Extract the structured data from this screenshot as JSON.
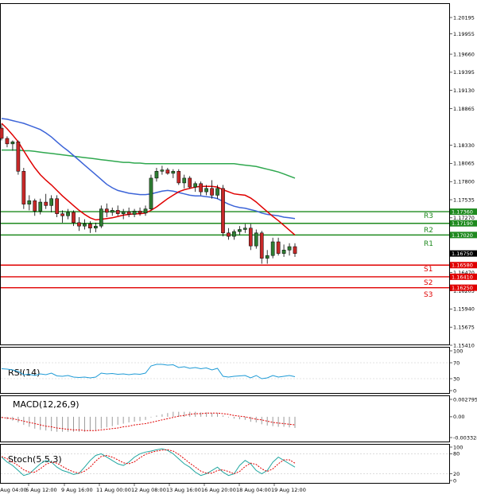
{
  "main": {
    "price_ticks": [
      "1.20195",
      "1.19955",
      "1.19660",
      "1.19395",
      "1.19130",
      "1.18865",
      "1.18330",
      "1.18065",
      "1.17800",
      "1.17535",
      "1.17270",
      "1.16470",
      "1.16205",
      "1.15940",
      "1.15675",
      "1.15410"
    ],
    "current_price": "1.16750",
    "current_color": "#000000",
    "resistance": [
      {
        "name": "R3",
        "value": "1.17360"
      },
      {
        "name": "R2",
        "value": "1.17190"
      },
      {
        "name": "R1",
        "value": "1.17020"
      }
    ],
    "support": [
      {
        "name": "S1",
        "value": "1.16580"
      },
      {
        "name": "S2",
        "value": "1.16410"
      },
      {
        "name": "S3",
        "value": "1.16250"
      }
    ],
    "resistance_color": "#1f8a1f",
    "support_color": "#e00000",
    "ma_colors": {
      "fast": "#e00000",
      "mid": "#3c64d8",
      "slow": "#2fa84f"
    }
  },
  "rsi": {
    "title": "RSI(14)",
    "ticks": [
      "100",
      "70",
      "30",
      "0"
    ],
    "color": "#1f9bd6"
  },
  "macd": {
    "title": "MACD(12,26,9)",
    "ticks": [
      "0.002795",
      "0.00",
      "-0.003328"
    ],
    "signal_color": "#e00000"
  },
  "stoch": {
    "title": "Stoch(5,5,3)",
    "ticks": [
      "100",
      "80",
      "20",
      "0"
    ],
    "main_color": "#1fa6a0",
    "signal_color": "#e00000"
  },
  "x_labels": [
    "5 Aug 04:00",
    "6 Aug 12:00",
    "9 Aug 16:00",
    "11 Aug 00:00",
    "12 Aug 08:00",
    "13 Aug 16:00",
    "16 Aug 20:00",
    "18 Aug 04:00",
    "19 Aug 12:00"
  ],
  "chart_data": {
    "type": "candlestick",
    "candles": [
      {
        "o": 1.1858,
        "h": 1.1864,
        "l": 1.184,
        "c": 1.1843
      },
      {
        "o": 1.1843,
        "h": 1.1846,
        "l": 1.183,
        "c": 1.1835
      },
      {
        "o": 1.1835,
        "h": 1.184,
        "l": 1.1825,
        "c": 1.1838
      },
      {
        "o": 1.1838,
        "h": 1.184,
        "l": 1.179,
        "c": 1.1795
      },
      {
        "o": 1.1795,
        "h": 1.18,
        "l": 1.174,
        "c": 1.1747
      },
      {
        "o": 1.1747,
        "h": 1.176,
        "l": 1.1738,
        "c": 1.1752
      },
      {
        "o": 1.1752,
        "h": 1.1755,
        "l": 1.173,
        "c": 1.1737
      },
      {
        "o": 1.1737,
        "h": 1.1755,
        "l": 1.1732,
        "c": 1.175
      },
      {
        "o": 1.175,
        "h": 1.1762,
        "l": 1.174,
        "c": 1.1745
      },
      {
        "o": 1.1745,
        "h": 1.176,
        "l": 1.1735,
        "c": 1.1755
      },
      {
        "o": 1.1755,
        "h": 1.176,
        "l": 1.1728,
        "c": 1.1733
      },
      {
        "o": 1.1733,
        "h": 1.1738,
        "l": 1.172,
        "c": 1.173
      },
      {
        "o": 1.173,
        "h": 1.174,
        "l": 1.1725,
        "c": 1.1735
      },
      {
        "o": 1.1735,
        "h": 1.1738,
        "l": 1.1715,
        "c": 1.172
      },
      {
        "o": 1.172,
        "h": 1.1728,
        "l": 1.1708,
        "c": 1.1715
      },
      {
        "o": 1.1715,
        "h": 1.1725,
        "l": 1.171,
        "c": 1.1718
      },
      {
        "o": 1.1718,
        "h": 1.1722,
        "l": 1.1705,
        "c": 1.1712
      },
      {
        "o": 1.1712,
        "h": 1.172,
        "l": 1.1706,
        "c": 1.1715
      },
      {
        "o": 1.1715,
        "h": 1.1745,
        "l": 1.1712,
        "c": 1.174
      },
      {
        "o": 1.174,
        "h": 1.1748,
        "l": 1.1728,
        "c": 1.1735
      },
      {
        "o": 1.1735,
        "h": 1.1742,
        "l": 1.173,
        "c": 1.1738
      },
      {
        "o": 1.1738,
        "h": 1.1745,
        "l": 1.173,
        "c": 1.1733
      },
      {
        "o": 1.1733,
        "h": 1.174,
        "l": 1.1725,
        "c": 1.1736
      },
      {
        "o": 1.1736,
        "h": 1.1742,
        "l": 1.1728,
        "c": 1.1732
      },
      {
        "o": 1.1732,
        "h": 1.174,
        "l": 1.1728,
        "c": 1.1737
      },
      {
        "o": 1.1737,
        "h": 1.1742,
        "l": 1.173,
        "c": 1.1734
      },
      {
        "o": 1.1734,
        "h": 1.1745,
        "l": 1.173,
        "c": 1.174
      },
      {
        "o": 1.174,
        "h": 1.179,
        "l": 1.1738,
        "c": 1.1785
      },
      {
        "o": 1.1785,
        "h": 1.18,
        "l": 1.178,
        "c": 1.1795
      },
      {
        "o": 1.1795,
        "h": 1.1803,
        "l": 1.179,
        "c": 1.1797
      },
      {
        "o": 1.1797,
        "h": 1.18,
        "l": 1.179,
        "c": 1.1792
      },
      {
        "o": 1.1792,
        "h": 1.1798,
        "l": 1.1785,
        "c": 1.1795
      },
      {
        "o": 1.1795,
        "h": 1.1798,
        "l": 1.1775,
        "c": 1.1778
      },
      {
        "o": 1.1778,
        "h": 1.179,
        "l": 1.177,
        "c": 1.1785
      },
      {
        "o": 1.1785,
        "h": 1.1788,
        "l": 1.177,
        "c": 1.1772
      },
      {
        "o": 1.1772,
        "h": 1.178,
        "l": 1.1765,
        "c": 1.1777
      },
      {
        "o": 1.1777,
        "h": 1.178,
        "l": 1.176,
        "c": 1.1765
      },
      {
        "o": 1.1765,
        "h": 1.1775,
        "l": 1.176,
        "c": 1.177
      },
      {
        "o": 1.177,
        "h": 1.1782,
        "l": 1.1755,
        "c": 1.176
      },
      {
        "o": 1.176,
        "h": 1.1775,
        "l": 1.1755,
        "c": 1.177
      },
      {
        "o": 1.177,
        "h": 1.1775,
        "l": 1.17,
        "c": 1.1705
      },
      {
        "o": 1.1705,
        "h": 1.1712,
        "l": 1.1695,
        "c": 1.17
      },
      {
        "o": 1.17,
        "h": 1.171,
        "l": 1.1695,
        "c": 1.1707
      },
      {
        "o": 1.1707,
        "h": 1.1715,
        "l": 1.1702,
        "c": 1.171
      },
      {
        "o": 1.171,
        "h": 1.1718,
        "l": 1.1705,
        "c": 1.1712
      },
      {
        "o": 1.1712,
        "h": 1.1718,
        "l": 1.168,
        "c": 1.1686
      },
      {
        "o": 1.1686,
        "h": 1.171,
        "l": 1.1682,
        "c": 1.1705
      },
      {
        "o": 1.1705,
        "h": 1.1708,
        "l": 1.166,
        "c": 1.1668
      },
      {
        "o": 1.1668,
        "h": 1.168,
        "l": 1.166,
        "c": 1.1672
      },
      {
        "o": 1.1672,
        "h": 1.1698,
        "l": 1.1668,
        "c": 1.1692
      },
      {
        "o": 1.1692,
        "h": 1.1698,
        "l": 1.1672,
        "c": 1.1675
      },
      {
        "o": 1.1675,
        "h": 1.1688,
        "l": 1.167,
        "c": 1.168
      },
      {
        "o": 1.168,
        "h": 1.169,
        "l": 1.1672,
        "c": 1.1685
      },
      {
        "o": 1.1685,
        "h": 1.169,
        "l": 1.167,
        "c": 1.1675
      }
    ],
    "ma_fast": [
      1.1865,
      1.1857,
      1.1848,
      1.1838,
      1.1825,
      1.1812,
      1.18,
      1.179,
      1.1782,
      1.1775,
      1.1767,
      1.1759,
      1.1752,
      1.1745,
      1.1738,
      1.1732,
      1.1727,
      1.1724,
      1.1725,
      1.1726,
      1.1727,
      1.1729,
      1.1731,
      1.1732,
      1.1733,
      1.1733,
      1.1734,
      1.1738,
      1.1743,
      1.1749,
      1.1755,
      1.176,
      1.1765,
      1.1768,
      1.177,
      1.1772,
      1.1773,
      1.1773,
      1.1773,
      1.1772,
      1.1768,
      1.1765,
      1.1762,
      1.1761,
      1.176,
      1.1756,
      1.175,
      1.1743,
      1.1736,
      1.1729,
      1.1723,
      1.1716,
      1.1709,
      1.1702
    ],
    "ma_mid": [
      1.1872,
      1.1871,
      1.1869,
      1.1867,
      1.1865,
      1.1862,
      1.1859,
      1.1856,
      1.1851,
      1.1845,
      1.1838,
      1.1831,
      1.1825,
      1.1818,
      1.1811,
      1.1804,
      1.1797,
      1.179,
      1.1783,
      1.1776,
      1.1771,
      1.1767,
      1.1765,
      1.1763,
      1.1762,
      1.1761,
      1.1761,
      1.1762,
      1.1764,
      1.1766,
      1.1767,
      1.1766,
      1.1764,
      1.1762,
      1.176,
      1.1759,
      1.1759,
      1.1758,
      1.1757,
      1.1755,
      1.1751,
      1.1747,
      1.1744,
      1.1742,
      1.1741,
      1.1739,
      1.1737,
      1.1734,
      1.1732,
      1.1731,
      1.173,
      1.1728,
      1.1727,
      1.1726
    ],
    "ma_slow": [
      1.1826,
      1.1826,
      1.1826,
      1.1826,
      1.1825,
      1.1825,
      1.1824,
      1.1823,
      1.1822,
      1.1821,
      1.182,
      1.1819,
      1.1818,
      1.1817,
      1.1816,
      1.1815,
      1.1814,
      1.1813,
      1.1812,
      1.1811,
      1.181,
      1.1809,
      1.1808,
      1.1808,
      1.1807,
      1.1807,
      1.1806,
      1.1806,
      1.1806,
      1.1806,
      1.1806,
      1.1806,
      1.1806,
      1.1806,
      1.1806,
      1.1806,
      1.1806,
      1.1806,
      1.1806,
      1.1806,
      1.1806,
      1.1806,
      1.1806,
      1.1805,
      1.1804,
      1.1803,
      1.1802,
      1.18,
      1.1798,
      1.1796,
      1.1794,
      1.1791,
      1.1788,
      1.1785
    ],
    "rsi": [
      55,
      54,
      52,
      48,
      40,
      41,
      38,
      42,
      40,
      44,
      37,
      36,
      38,
      34,
      33,
      34,
      32,
      34,
      44,
      42,
      43,
      41,
      42,
      40,
      42,
      41,
      44,
      62,
      66,
      66,
      64,
      65,
      58,
      60,
      56,
      58,
      55,
      57,
      52,
      56,
      36,
      34,
      36,
      37,
      38,
      32,
      38,
      30,
      32,
      38,
      34,
      36,
      38,
      35
    ],
    "macd": [
      -0.0002,
      -0.0004,
      -0.0006,
      -0.0009,
      -0.0013,
      -0.0016,
      -0.0019,
      -0.0021,
      -0.0022,
      -0.0023,
      -0.0024,
      -0.0024,
      -0.0024,
      -0.0024,
      -0.0024,
      -0.0024,
      -0.0023,
      -0.0022,
      -0.0019,
      -0.0017,
      -0.0015,
      -0.0013,
      -0.0011,
      -0.0009,
      -0.0008,
      -0.0007,
      -0.0005,
      -0.0001,
      0.0002,
      0.0004,
      0.0006,
      0.0008,
      0.0008,
      0.0008,
      0.0008,
      0.0008,
      0.0007,
      0.0007,
      0.0006,
      0.0006,
      0.0002,
      -0.0001,
      -0.0003,
      -0.0004,
      -0.0005,
      -0.0008,
      -0.0009,
      -0.0012,
      -0.0014,
      -0.0015,
      -0.0016,
      -0.0016,
      -0.0017,
      -0.0018
    ],
    "macd_signal": [
      -0.0001,
      -0.0002,
      -0.0003,
      -0.0005,
      -0.0007,
      -0.0009,
      -0.0011,
      -0.0013,
      -0.0015,
      -0.0016,
      -0.0018,
      -0.0019,
      -0.002,
      -0.0021,
      -0.0021,
      -0.0022,
      -0.0022,
      -0.0022,
      -0.0021,
      -0.002,
      -0.0019,
      -0.0018,
      -0.0016,
      -0.0015,
      -0.0013,
      -0.0012,
      -0.0011,
      -0.0009,
      -0.0007,
      -0.0005,
      -0.0003,
      -0.0001,
      0.0001,
      0.0002,
      0.0004,
      0.0005,
      0.0005,
      0.0006,
      0.0006,
      0.0006,
      0.0005,
      0.0004,
      0.0002,
      0.0001,
      0.0,
      -0.0002,
      -0.0004,
      -0.0005,
      -0.0007,
      -0.0009,
      -0.001,
      -0.0011,
      -0.0012,
      -0.0013
    ],
    "stoch_main": [
      70,
      55,
      45,
      30,
      15,
      20,
      35,
      50,
      60,
      55,
      40,
      30,
      25,
      18,
      22,
      40,
      60,
      75,
      80,
      70,
      60,
      50,
      45,
      55,
      70,
      80,
      85,
      88,
      92,
      95,
      90,
      80,
      65,
      50,
      40,
      25,
      15,
      20,
      30,
      40,
      25,
      15,
      20,
      45,
      60,
      50,
      30,
      20,
      30,
      55,
      70,
      60,
      50,
      40
    ],
    "stoch_signal": [
      72,
      65,
      55,
      45,
      32,
      25,
      25,
      35,
      48,
      55,
      52,
      42,
      33,
      26,
      22,
      28,
      40,
      58,
      72,
      75,
      70,
      62,
      53,
      50,
      56,
      68,
      78,
      84,
      88,
      91,
      92,
      88,
      78,
      65,
      52,
      40,
      28,
      22,
      22,
      30,
      32,
      27,
      20,
      27,
      42,
      52,
      48,
      35,
      27,
      35,
      50,
      62,
      62,
      52
    ]
  }
}
